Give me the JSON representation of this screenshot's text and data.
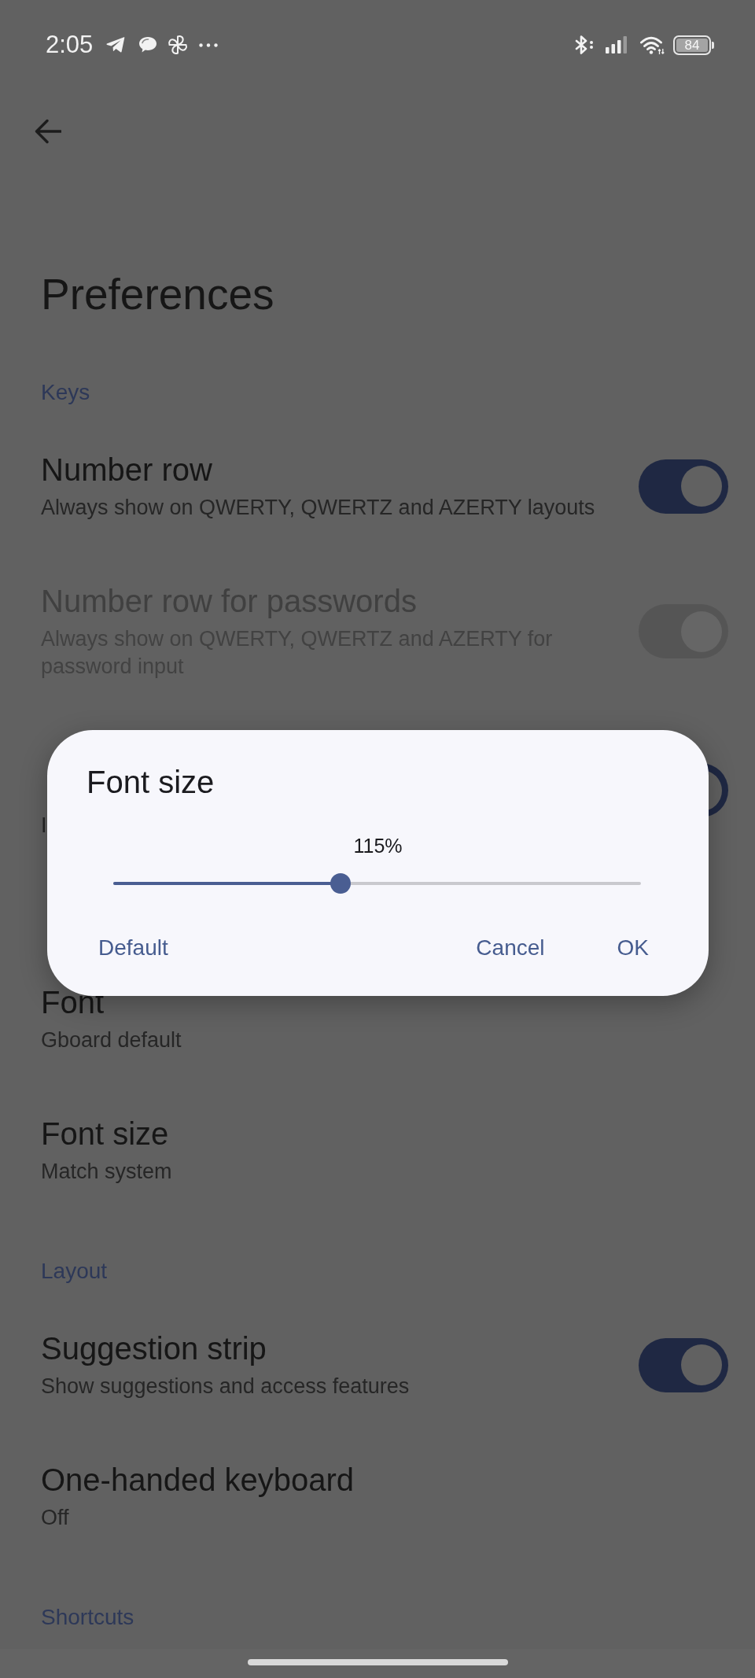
{
  "status_bar": {
    "time": "2:05",
    "battery": "84"
  },
  "title": "Preferences",
  "sections": [
    {
      "label": "Keys",
      "items": [
        {
          "kind": "toggle",
          "title": "Number row",
          "subtitle": "Always show on QWERTY, QWERTZ and AZERTY layouts",
          "on": true,
          "disabled": false
        },
        {
          "kind": "toggle",
          "title": "Number row for passwords",
          "subtitle": "Always show on QWERTY, QWERTZ and AZERTY for password input",
          "on": true,
          "disabled": true
        },
        {
          "kind": "toggle",
          "subtitle_line_2": "I",
          "on": true,
          "disabled": false
        }
      ]
    },
    {
      "items": [
        {
          "kind": "link",
          "title": "Font",
          "subtitle": "Gboard default",
          "disabled": false
        },
        {
          "kind": "link",
          "title": "Font size",
          "subtitle": "Match system",
          "disabled": false
        }
      ]
    },
    {
      "label": "Layout",
      "items": [
        {
          "kind": "toggle",
          "title": "Suggestion strip",
          "subtitle": "Show suggestions and access features",
          "on": true,
          "disabled": false
        },
        {
          "kind": "link",
          "title": "One-handed keyboard",
          "subtitle": "Off",
          "disabled": false
        }
      ]
    },
    {
      "label": "Shortcuts"
    }
  ],
  "dialog": {
    "title": "Font size",
    "value": "115%",
    "slider": {
      "level": 0.43
    },
    "buttons": [
      {
        "label": "Default"
      },
      {
        "label": "Cancel"
      },
      {
        "label": "OK"
      }
    ]
  }
}
